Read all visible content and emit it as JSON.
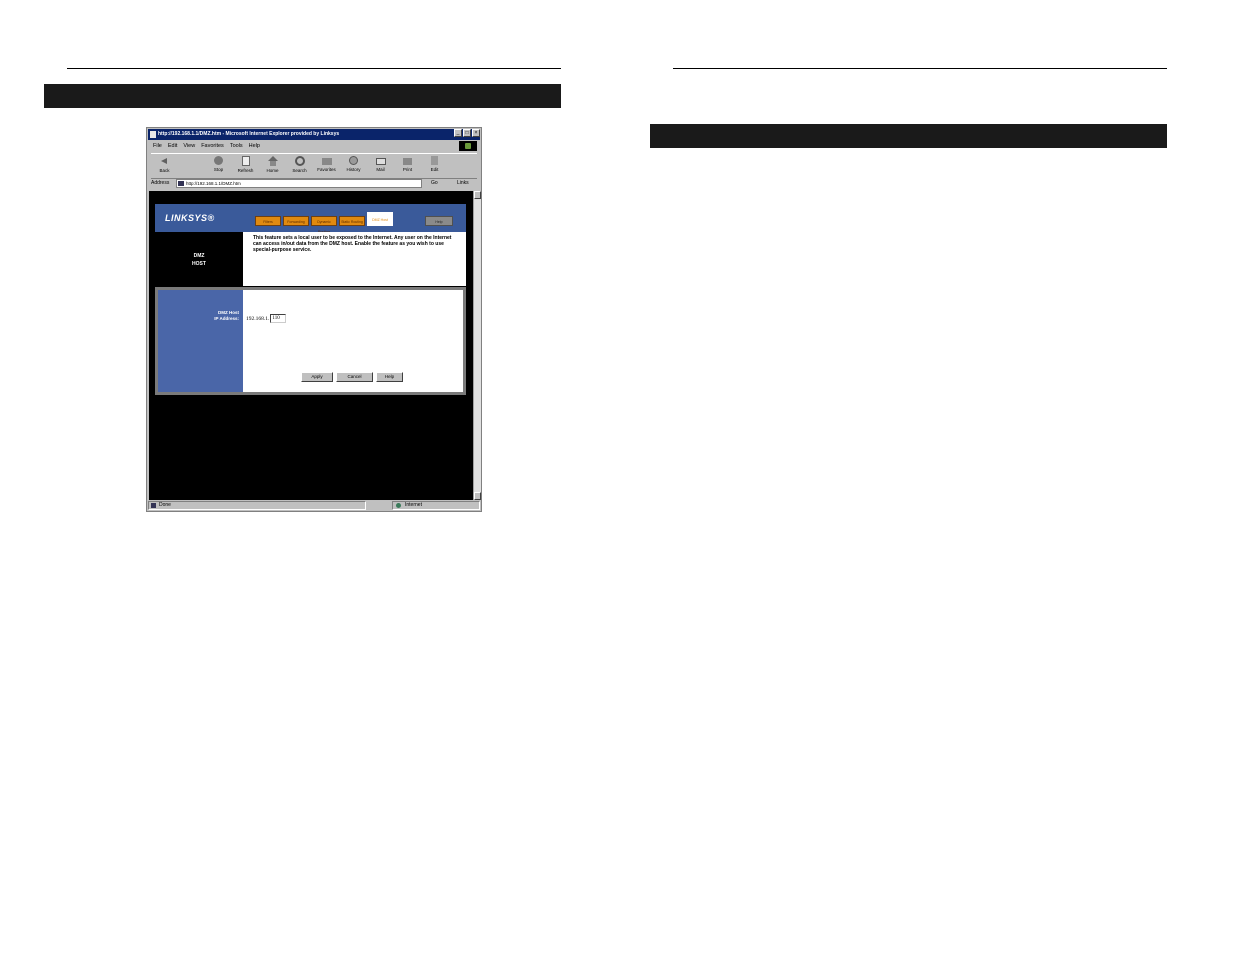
{
  "browser": {
    "title": "http://192.168.1.1/DMZ.htm - Microsoft Internet Explorer provided by Linksys",
    "window_buttons": [
      "_",
      "□",
      "×"
    ],
    "menu": [
      "File",
      "Edit",
      "View",
      "Favorites",
      "Tools",
      "Help"
    ],
    "toolbar": [
      "Back",
      "",
      "Stop",
      "Refresh",
      "Home",
      "Search",
      "Favorites",
      "History",
      "Mail",
      "Print",
      "Edit"
    ],
    "address_label": "Address",
    "address_value": "http://192.168.1.1/DMZ.htm",
    "go_label": "Go",
    "links_label": "Links",
    "status_left": "Done",
    "status_right": "Internet"
  },
  "linksys": {
    "logo": "LINKSYS®",
    "tabs": [
      "Filters",
      "Forwarding",
      "Dynamic Routing",
      "Static Routing",
      "DMZ Host"
    ],
    "help_tab": "Help",
    "section_title_line1": "DMZ",
    "section_title_line2": "HOST",
    "description": "This feature sets a local user to be exposed to the Internet. Any user on the Internet can access in/out data from the DMZ host. Enable the feature as you wish to use special-purpose service.",
    "field_label_line1": "DMZ Host",
    "field_label_line2": "IP Address:",
    "ip_prefix": "192.168.1.",
    "ip_value": "110",
    "apply": "Apply",
    "cancel": "Cancel",
    "help": "Help"
  }
}
